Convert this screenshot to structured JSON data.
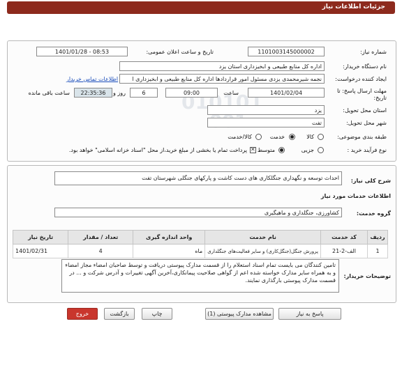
{
  "title": "جزئیات اطلاعات نیاز",
  "labels": {
    "need_number": "شماره نیاز:",
    "announce_datetime": "تاریخ و ساعت اعلان عمومی:",
    "buyer_org": "نام دستگاه خریدار:",
    "requester": "ایجاد کننده درخواست:",
    "reply_deadline": "مهلت ارسال پاسخ: تا",
    "reply_deadline_2": "تاریخ:",
    "hour": "ساعت",
    "day_and": "روز و",
    "remaining": "ساعت باقی مانده",
    "province": "استان محل تحویل:",
    "city": "شهر محل تحویل:",
    "category": "طبقه بندی موضوعی:",
    "purchase_process": "نوع فرآیند خرید :",
    "general_desc": "شرح کلی نیاز:",
    "services_info": "اطلاعات خدمات مورد نیاز",
    "service_group": "گروه خدمت:",
    "buyer_notes": "توضیحات خریدار:"
  },
  "fields": {
    "need_number": "1101003145000002",
    "announce_datetime": "1401/01/28 - 08:53",
    "buyer_org": "اداره کل منابع طبیعی و ابخیزداری استان یزد",
    "requester": "نجمه شیرمحمدی یزدی مسئول امور قراردادها اداره کل منابع طبیعی و ابخیزداری ا",
    "contact_link": "اطلاعات تماس خریدار",
    "deadline_date": "1401/02/04",
    "deadline_time": "09:00",
    "days": "6",
    "countdown": "22:35:36",
    "province": "یزد",
    "city": "تفت"
  },
  "category_options": [
    {
      "label": "کالا",
      "selected": false
    },
    {
      "label": "خدمت",
      "selected": true
    },
    {
      "label": "کالا/خدمت",
      "selected": false
    }
  ],
  "process_options": [
    {
      "label": "جزیی",
      "selected": false
    },
    {
      "label": "متوسط",
      "selected": true
    }
  ],
  "payment_note": "پرداخت تمام یا بخشی از مبلغ خرید،از محل \"اسناد خزانه اسلامی\" خواهد بود.",
  "general_desc": "احداث توسعه و نگهداری جنگلکاری های دست کاشت و پارکهای جنگلی شهرستان تفت",
  "service_group": "کشاورزی، جنگلداری و ماهیگیری",
  "table": {
    "headers": [
      "ردیف",
      "کد خدمت",
      "نام خدمت",
      "واحد اندازه گیری",
      "تعداد / مقدار",
      "تاریخ نیاز"
    ],
    "rows": [
      [
        "1",
        "الف-2-21",
        "پرورش جنگل(جنگل‌کاری) و سایر فعالیت‌های جنگلداری",
        "ماه",
        "4",
        "1401/02/31"
      ]
    ]
  },
  "buyer_notes": "تامین کنندگان می بایست تمام اسناد استعلام را از قسمت مدارک پیوستی دریافت و توسط صاحبان امضاء مجاز امضاء و به همراه سایر مدارک خواسته شده اعم از گواهی صلاحیت پیمانکاری،آخرین آگهی تغییرات و آدرس شرکت و ... در قسمت مدارک پیوستی بارگذاری نمایند.",
  "buttons": {
    "reply": "پاسخ به نیاز",
    "attachments": "مشاهده مدارک پیوستی (1)",
    "print": "چاپ",
    "back": "بازگشت",
    "exit": "خروج"
  },
  "watermark": {
    "number_top": "010101",
    "number_bottom": "001",
    "brand": "ParsNamadata",
    "subtitle": "پایگاه اطلاع رسانی مناقصه و مزایده"
  }
}
